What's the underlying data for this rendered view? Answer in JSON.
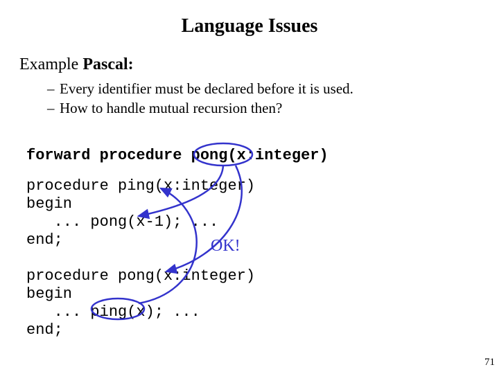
{
  "title": "Language Issues",
  "subtitle": {
    "prefix": "Example ",
    "bold": "Pascal:"
  },
  "bullets": [
    "Every identifier must be declared before it is used.",
    "How to handle mutual recursion then?"
  ],
  "code": {
    "forward": "forward procedure pong(x:integer)",
    "body": "procedure ping(x:integer)\nbegin\n   ... pong(x-1); ...\nend;\n\nprocedure pong(x:integer)\nbegin\n   ... ping(x); ...\nend;"
  },
  "annotation": {
    "ok": "OK!"
  },
  "page_number": "71",
  "arrow_color": "#3333cc"
}
